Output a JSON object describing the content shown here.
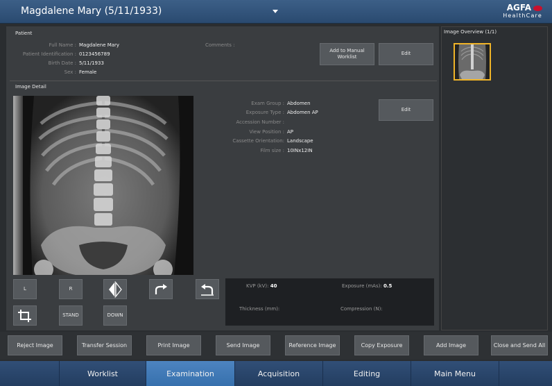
{
  "header": {
    "title": "Magdalene Mary (5/11/1933)",
    "logo_top": "AGFA",
    "logo_bottom": "HealthCare"
  },
  "patient": {
    "section_label": "Patient",
    "fields": [
      {
        "key": "Full Name :",
        "value": "Magdalene Mary"
      },
      {
        "key": "Patient Identification :",
        "value": "0123456789"
      },
      {
        "key": "Birth Date :",
        "value": "5/11/1933"
      },
      {
        "key": "Sex :",
        "value": "Female"
      }
    ],
    "comments_label": "Comments :",
    "add_worklist_label": "Add to Manual Worklist",
    "edit_label": "Edit"
  },
  "image_detail": {
    "section_label": "Image Detail",
    "fields": [
      {
        "key": "Exam Group :",
        "value": "Abdomen"
      },
      {
        "key": "Exposure Type :",
        "value": "Abdomen AP"
      },
      {
        "key": "Accession Number :",
        "value": ""
      },
      {
        "key": "View Position :",
        "value": "AP"
      },
      {
        "key": "Cassette Orientation:",
        "value": "Landscape"
      },
      {
        "key": "Film size :",
        "value": "10INx12IN"
      }
    ],
    "edit_label": "Edit"
  },
  "tools": {
    "l_label": "L",
    "r_label": "R",
    "stand_label": "STAND",
    "down_label": "DOWN"
  },
  "exposure_info": {
    "kvp_label": "KVP (kV):",
    "kvp_value": "40",
    "mas_label": "Exposure (mAs):",
    "mas_value": "0.5",
    "thickness_label": "Thickness (mm):",
    "compression_label": "Compression (N):"
  },
  "overview": {
    "title": "Image Overview (1/1)"
  },
  "actions": [
    "Reject Image",
    "Transfer Session",
    "Print Image",
    "Send Image",
    "Reference Image",
    "Copy Exposure",
    "Add Image",
    "Close and Send All"
  ],
  "nav": {
    "items": [
      "Worklist",
      "Examination",
      "Acquisition",
      "Editing",
      "Main Menu"
    ],
    "active": "Examination"
  },
  "colors": {
    "accent": "#3670ad",
    "thumb_border": "#f0b428"
  }
}
